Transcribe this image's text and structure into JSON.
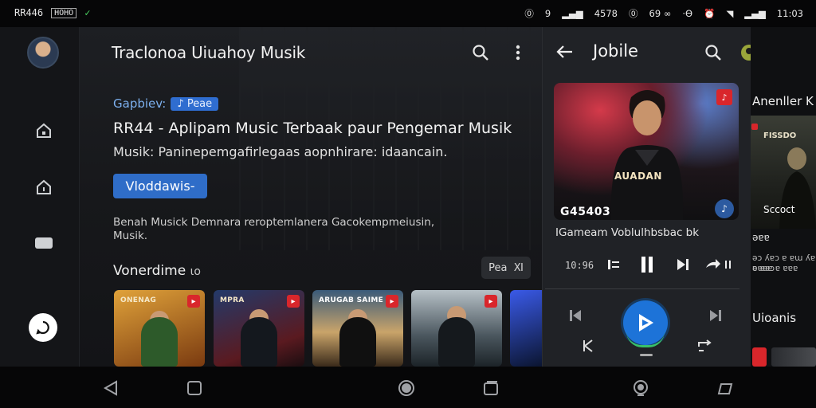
{
  "status_bar": {
    "left_text": "RR446",
    "left_badge": "HOHO",
    "left_check": "✓",
    "right_items": [
      "⓪",
      "9",
      "4578",
      "⓪",
      "69 ∞",
      "·Ɵ"
    ],
    "time": "11:03"
  },
  "main": {
    "title": "Traclonoa Uiuahoy Musik",
    "category_label": "Gapbiev:",
    "category_chip": "Peae",
    "headline": "RR44 - Aplipam Music Terbaak paur Pengemar Musik",
    "subline": "Musik: Paninepemgafirlegaas aopnhirare: idaancain.",
    "cta_label": "Vloddawis-",
    "description": "Benah Musick Demnara reroptemlanera Gacokempmeiusin, Musik.",
    "section_title": "Vonerdime",
    "section_suffix": "ιο",
    "see_all_label": "Pea",
    "see_all_suffix": "Ⅺ",
    "albums": [
      {
        "caption": "ONENAG",
        "colors": [
          "#d88a1c",
          "#7a3a10"
        ]
      },
      {
        "caption": "MPRA",
        "colors": [
          "#223a6a",
          "#5a1a20"
        ]
      },
      {
        "caption": "ARUGAB SAIME",
        "colors": [
          "#c9a46a",
          "#3a5a7a"
        ]
      },
      {
        "caption": "",
        "colors": [
          "#8a9aa6",
          "#1c2328"
        ]
      },
      {
        "caption": "",
        "colors": [
          "#2a4ab8",
          "#0b1530"
        ]
      }
    ]
  },
  "player": {
    "title": "Jobile",
    "track_code": "G45403",
    "track_name": "IGameam Voblulhbsbac bk",
    "elapsed": "10:96",
    "shirt_text": "AUADAN"
  },
  "side": {
    "header": "Anenller K",
    "card_text": "FISSDO",
    "line1": "Sccoct",
    "line2": "ǝɐɐ",
    "line3": "ǝɔ ʎɐɔ ɐ ɐɯ ʎɐ ɐ ɐɐɔ",
    "line4": "ǝɐɐɐ ɐ ɐɐɐ",
    "footer": "Uioanis"
  }
}
